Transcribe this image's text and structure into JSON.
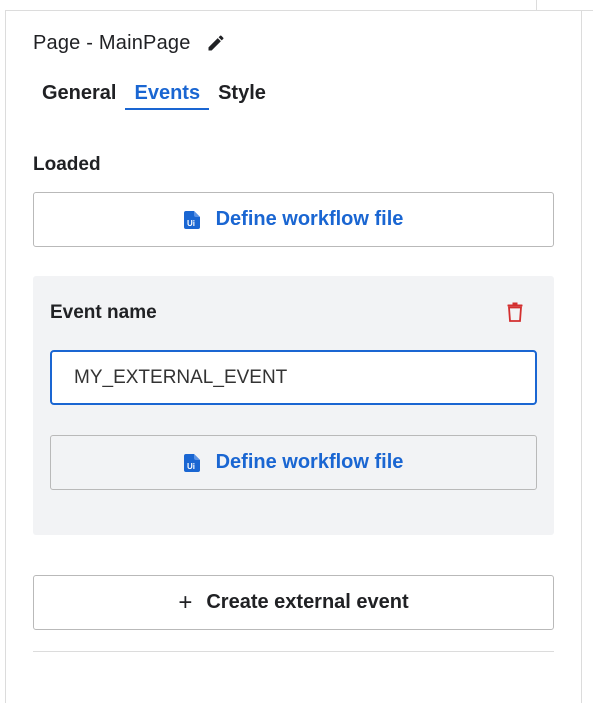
{
  "header": {
    "title": "Page - MainPage",
    "edit_icon": "pencil-icon"
  },
  "tabs": [
    {
      "label": "General",
      "active": false
    },
    {
      "label": "Events",
      "active": true
    },
    {
      "label": "Style",
      "active": false
    }
  ],
  "loaded": {
    "label": "Loaded",
    "workflow_button_label": "Define workflow file",
    "workflow_icon": "uipath-file-icon"
  },
  "event_card": {
    "label": "Event name",
    "delete_icon": "trash-icon",
    "input_value": "MY_EXTERNAL_EVENT",
    "workflow_button_label": "Define workflow file",
    "workflow_icon": "uipath-file-icon"
  },
  "create_button": {
    "icon": "+",
    "label": "Create external event"
  },
  "colors": {
    "accent": "#1a66d2",
    "danger": "#d32f2f",
    "card_bg": "#f2f3f5",
    "border": "#b9b9b9"
  }
}
